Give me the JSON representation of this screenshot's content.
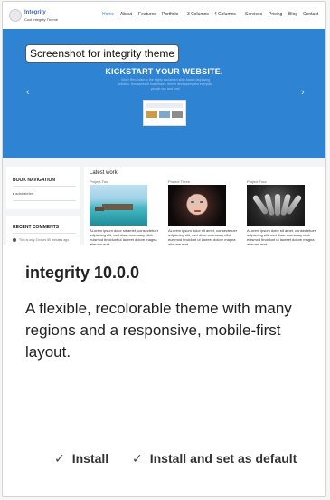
{
  "screenshot": {
    "site_name": "Integrity",
    "site_slogan": "Cool Integrity Theme",
    "nav": [
      "Home",
      "About",
      "Features",
      "Portfolio",
      "3 Columns",
      "4 Columns",
      "Services",
      "Pricing",
      "Blog",
      "Contact"
    ],
    "nav_active": "Home",
    "caption": "Screenshot for integrity theme",
    "hero": {
      "title": "KICKSTART YOUR WEBSITE.",
      "text": "Slider Revolution is the highly acclaimed slide-based displaying solution. thousands of businesses, theme developers and everyday people use and love!",
      "prev_arrow": "‹",
      "next_arrow": "›"
    },
    "sidebar": {
      "nav_title": "BOOK NAVIGATION",
      "nav_link": "adstratetert",
      "comments_title": "RECENT COMMENTS",
      "comment_text": "This is only 3 hours 50 minutes ago"
    },
    "latest_work": {
      "title": "Latest work",
      "projects": [
        {
          "name": "Project Two",
          "text": "ALorem ipsum dolor sit amet, consectetuer adipiscing elit, sed diam nonummy nibh euismod tincidunt ut laoreet dolore magna aliquam erat"
        },
        {
          "name": "Project Three",
          "text": "ALorem ipsum dolor sit amet, consectetuer adipiscing elit, sed diam nonummy nibh euismod tincidunt ut laoreet dolore magna aliquam erat"
        },
        {
          "name": "Project Four",
          "text": "ALorem ipsum dolor sit amet, consectetuer adipiscing elit, sed diam nonummy nibh euismod tincidunt ut laoreet dolore magna aliquam erat"
        }
      ]
    }
  },
  "theme": {
    "name": "integrity 10.0.0",
    "description": "A flexible, recolorable theme with many regions and a responsive, mobile-first layout."
  },
  "actions": {
    "install_label": "Install",
    "install_default_label": "Install and set as default"
  },
  "colors": {
    "hero_blue": "#2f83d3",
    "nav_active": "#3a8ee6"
  }
}
